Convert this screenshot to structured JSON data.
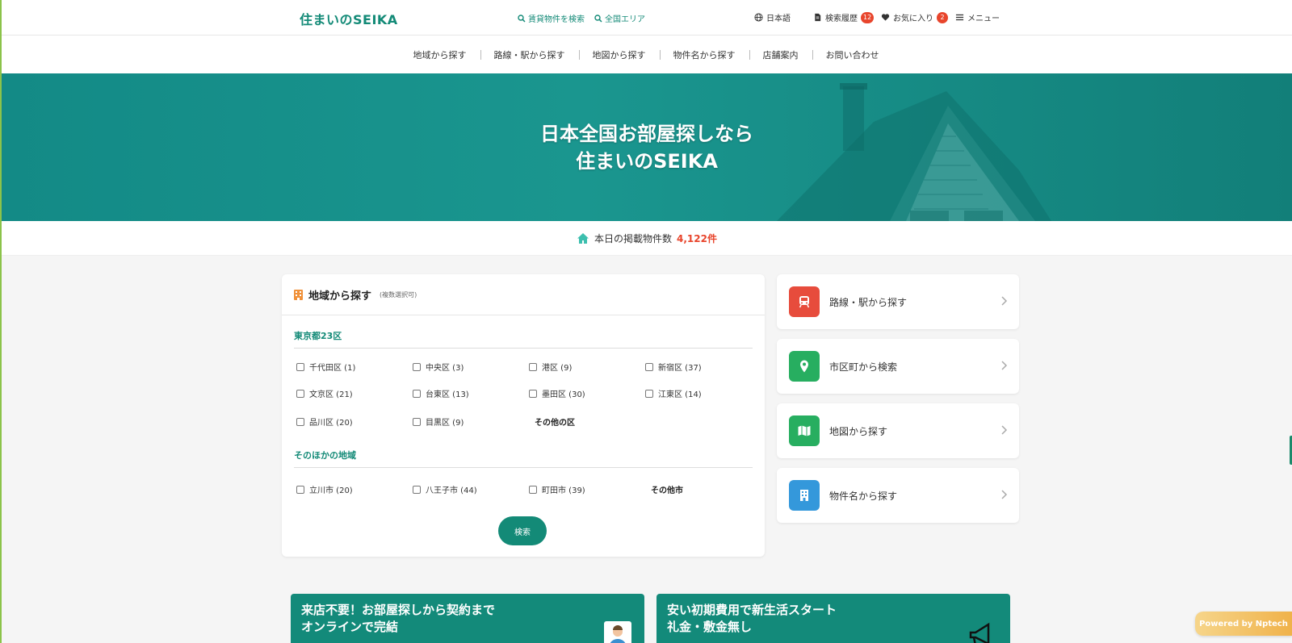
{
  "header": {
    "logo": "住まいのSEIKA",
    "search_rental": "賃貸物件を検索",
    "all_area": "全国エリア",
    "language": "日本語",
    "history": "検索履歴",
    "history_count": "12",
    "favorites": "お気に入り",
    "favorites_count": "2",
    "menu": "メニュー"
  },
  "nav": {
    "items": [
      "地域から探す",
      "路線・駅から探す",
      "地図から探す",
      "物件名から探す",
      "店舗案内",
      "お問い合わせ"
    ]
  },
  "hero": {
    "line1": "日本全国お部屋探しなら",
    "line2": "住まいのSEIKA"
  },
  "count": {
    "label": "本日の掲載物件数",
    "value": "4,122件"
  },
  "region": {
    "title": "地域から探す",
    "subtitle": "(複数選択可)",
    "group1": {
      "title": "東京都23区",
      "options": [
        "千代田区 (1)",
        "中央区 (3)",
        "港区 (9)",
        "新宿区 (37)",
        "文京区 (21)",
        "台東区 (13)",
        "墨田区 (30)",
        "江東区 (14)",
        "品川区 (20)",
        "目黒区 (9)"
      ],
      "more": "その他の区"
    },
    "group2": {
      "title": "そのほかの地域",
      "options": [
        "立川市 (20)",
        "八王子市 (44)",
        "町田市 (39)"
      ],
      "more": "その他市"
    },
    "search_button": "検索"
  },
  "cards": [
    {
      "label": "路線・駅から探す",
      "color": "#e74c3c",
      "icon": "train-icon"
    },
    {
      "label": "市区町から検索",
      "color": "#27ae60",
      "icon": "map-pin-icon"
    },
    {
      "label": "地図から探す",
      "color": "#27ae60",
      "icon": "map-icon"
    },
    {
      "label": "物件名から探す",
      "color": "#3498db",
      "icon": "building-icon"
    }
  ],
  "promos": [
    {
      "line1": "来店不要！お部屋探しから契約まで",
      "line2": "オンラインで完結"
    },
    {
      "line1": "安い初期費用で新生活スタート",
      "line2": "礼金・敷金無し"
    }
  ],
  "powered": "Powered by  Nptech",
  "colors": {
    "brand": "#138a77",
    "accent": "#e8452c"
  }
}
